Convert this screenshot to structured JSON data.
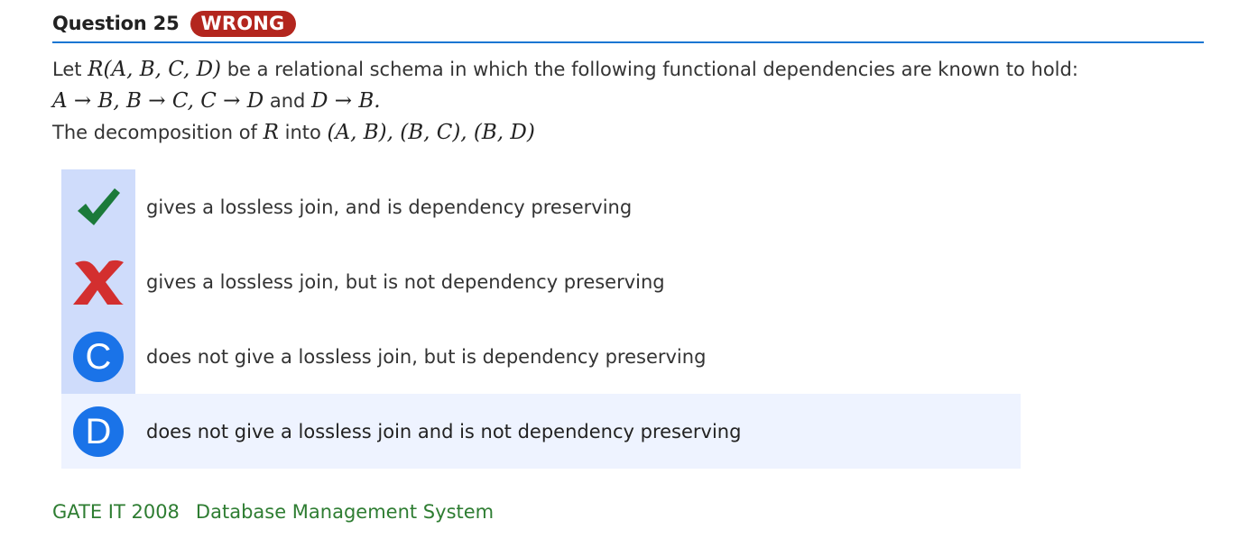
{
  "header": {
    "title": "Question 25",
    "status_badge": "WRONG"
  },
  "question": {
    "line1_prefix": "Let ",
    "line1_math": "R(A, B, C, D)",
    "line1_suffix": " be a relational schema in which the following functional dependencies are known to hold:",
    "line2_math_a": "A → B,  B → C,  C → D",
    "line2_mid": " and ",
    "line2_math_b": "D → B.",
    "line3_prefix": "The decomposition of ",
    "line3_math_r": "R",
    "line3_mid": " into ",
    "line3_math_d": "(A, B), (B, C), (B, D)"
  },
  "options": [
    {
      "marker": "check-icon",
      "text": "gives a lossless join, and is dependency preserving"
    },
    {
      "marker": "cross-icon",
      "text": "gives a lossless join, but is not dependency preserving"
    },
    {
      "marker": "C",
      "text": "does not give a lossless join, but is dependency preserving"
    },
    {
      "marker": "D",
      "text": "does not give a lossless join and is not dependency preserving"
    }
  ],
  "footer": {
    "tag_exam": "GATE IT 2008",
    "tag_subject": "Database Management System"
  },
  "colors": {
    "badge_wrong": "#b3261e",
    "header_rule": "#1976d2",
    "correct_check": "#1b7a3a",
    "wrong_cross": "#d32f2f",
    "option_circle": "#1a73e8",
    "tag_text": "#2e7d32",
    "answer_shade": "#cfdcfb",
    "selected_row": "#eef3ff"
  }
}
